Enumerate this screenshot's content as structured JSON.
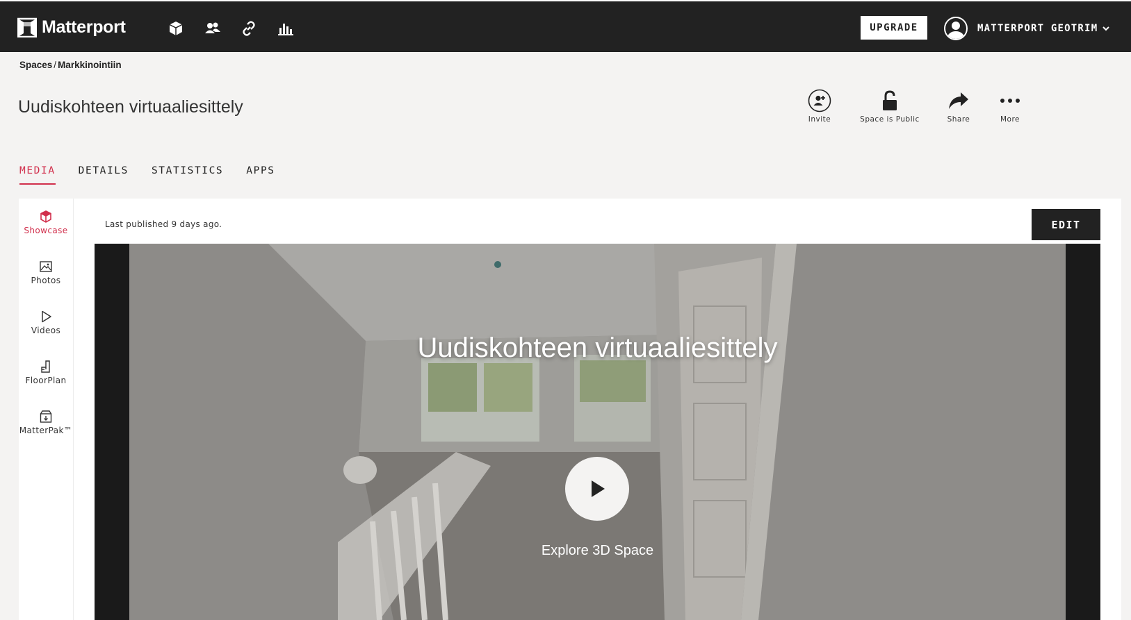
{
  "app": {
    "brand": "Matterport",
    "nav_icons": [
      "cube-icon",
      "users-icon",
      "link-icon",
      "bar-chart-icon"
    ],
    "upgrade_label": "UPGRADE",
    "user_name": "MATTERPORT GEOTRIM"
  },
  "breadcrumb": {
    "root": "Spaces",
    "separator": "/",
    "current": "Markkinointiin"
  },
  "page": {
    "title": "Uudiskohteen virtuaaliesittely"
  },
  "actions": [
    {
      "label": "Invite",
      "icon": "add-user-icon"
    },
    {
      "label": "Space is Public",
      "icon": "unlock-icon"
    },
    {
      "label": "Share",
      "icon": "share-arrow-icon"
    },
    {
      "label": "More",
      "icon": "more-dots-icon"
    }
  ],
  "tabs": [
    {
      "label": "MEDIA",
      "active": true
    },
    {
      "label": "DETAILS",
      "active": false
    },
    {
      "label": "STATISTICS",
      "active": false
    },
    {
      "label": "APPS",
      "active": false
    }
  ],
  "media_nav": [
    {
      "label": "Showcase",
      "icon": "cube-icon",
      "active": true
    },
    {
      "label": "Photos",
      "icon": "image-icon",
      "active": false
    },
    {
      "label": "Videos",
      "icon": "play-icon",
      "active": false
    },
    {
      "label": "FloorPlan",
      "icon": "floorplan-icon",
      "active": false
    },
    {
      "label": "MatterPak™",
      "icon": "package-icon",
      "active": false
    }
  ],
  "showcase": {
    "published_text": "Last published 9 days ago.",
    "edit_label": "EDIT",
    "viewer_title": "Uudiskohteen virtuaaliesittely",
    "explore_label": "Explore 3D Space"
  },
  "colors": {
    "accent": "#d12f4c",
    "topbar": "#222222",
    "background": "#f4f3f2"
  }
}
